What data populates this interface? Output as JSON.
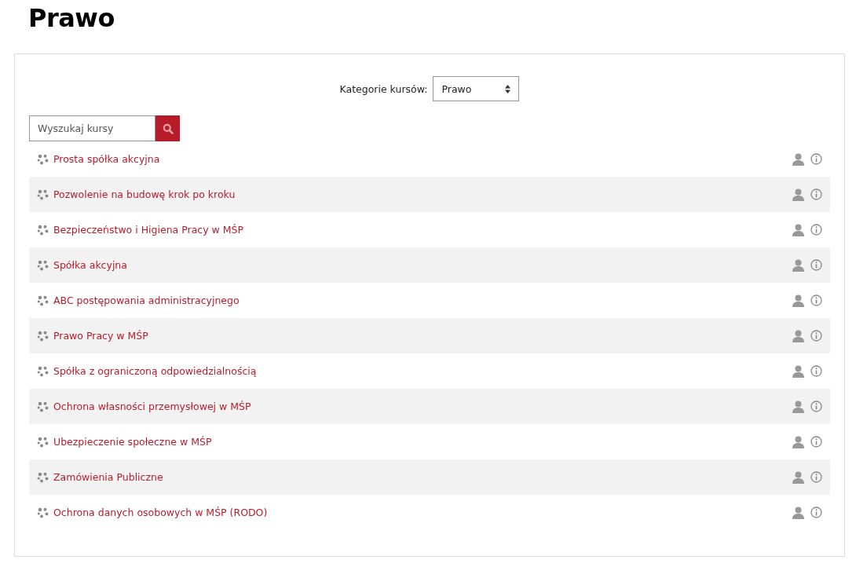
{
  "title": "Prawo",
  "category_select": {
    "label": "Kategorie kursów:",
    "value": "Prawo"
  },
  "search": {
    "placeholder": "Wyszukaj kursy"
  },
  "courses": [
    {
      "name": "Prosta spółka akcyjna"
    },
    {
      "name": "Pozwolenie na budowę krok po kroku"
    },
    {
      "name": "Bezpieczeństwo i Higiena Pracy w MŚP"
    },
    {
      "name": "Spółka akcyjna"
    },
    {
      "name": "ABC postępowania administracyjnego"
    },
    {
      "name": "Prawo Pracy w MŚP"
    },
    {
      "name": "Spółka z ograniczoną odpowiedzialnością"
    },
    {
      "name": "Ochrona własności przemysłowej w MŚP"
    },
    {
      "name": "Ubezpieczenie społeczne w MŚP"
    },
    {
      "name": "Zamówienia Publiczne"
    },
    {
      "name": "Ochrona danych osobowych w MŚP (RODO)"
    }
  ]
}
